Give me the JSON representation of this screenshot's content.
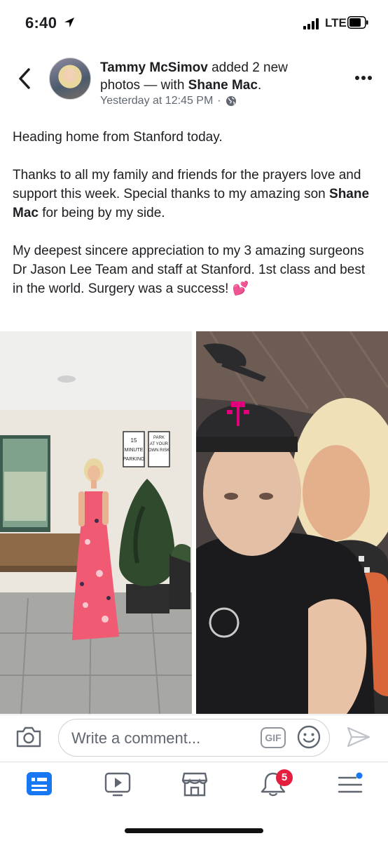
{
  "status_bar": {
    "time": "6:40",
    "network": "LTE",
    "icons": [
      "location-arrow-icon",
      "signal-bars-icon",
      "battery-icon"
    ]
  },
  "post": {
    "author": "Tammy McSimov",
    "action": " added 2 new photos — with ",
    "tagged": "Shane Mac",
    "period": ".",
    "timestamp": "Yesterday at 12:45 PM",
    "separator": "·",
    "privacy_icon": "globe-icon",
    "p1": "Heading home from Stanford today.",
    "p2_a": "Thanks to all my family and friends for the prayers love and support this week.  Special thanks to my amazing son ",
    "p2_name": "Shane Mac",
    "p2_b": " for being by my side.",
    "p3": "My deepest sincere appreciation to my 3 amazing surgeons Dr Jason Lee Team and staff at Stanford.  1st class and best in the world.    Surgery was a success!  ",
    "p3_emoji": "💕"
  },
  "photos": {
    "sign1": [
      "15",
      "MINUTE",
      "PARKING"
    ],
    "sign2": [
      "PARK",
      "AT YOUR",
      "OWN RISK"
    ]
  },
  "composer": {
    "placeholder": "Write a comment...",
    "gif_label": "GIF"
  },
  "tabs": [
    {
      "name": "news-feed",
      "icon": "news-feed-icon"
    },
    {
      "name": "watch",
      "icon": "video-icon"
    },
    {
      "name": "marketplace",
      "icon": "marketplace-icon"
    },
    {
      "name": "notifications",
      "icon": "bell-icon",
      "badge": "5"
    },
    {
      "name": "menu",
      "icon": "menu-icon"
    }
  ],
  "colors": {
    "accent": "#1877f2",
    "badge": "#e41e3f",
    "secondary_text": "#606770"
  }
}
